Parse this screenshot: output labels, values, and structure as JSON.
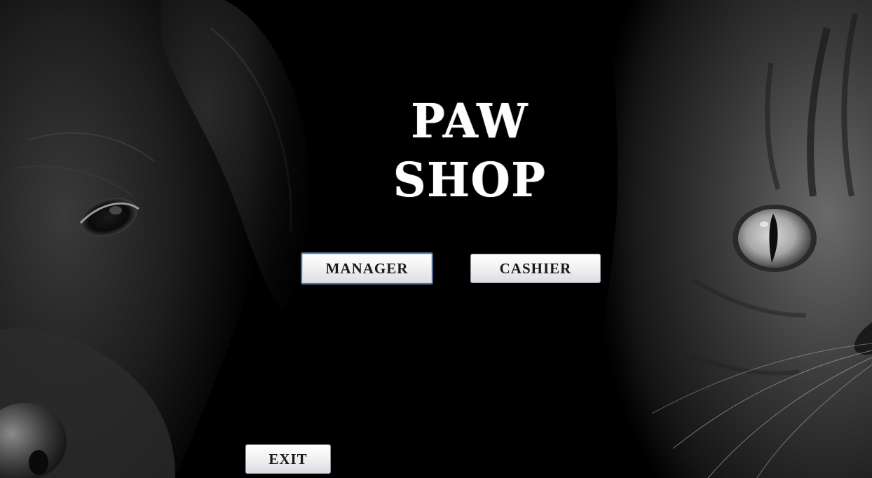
{
  "window": {
    "title": "PAW SHOP"
  },
  "buttons": {
    "manager": "MANAGER",
    "cashier": "CASHIER",
    "exit": "EXIT"
  },
  "colors": {
    "background": "#000000",
    "title": "#ffffff",
    "button_face": "#eeeef2",
    "focus_border": "#4f6f97"
  }
}
